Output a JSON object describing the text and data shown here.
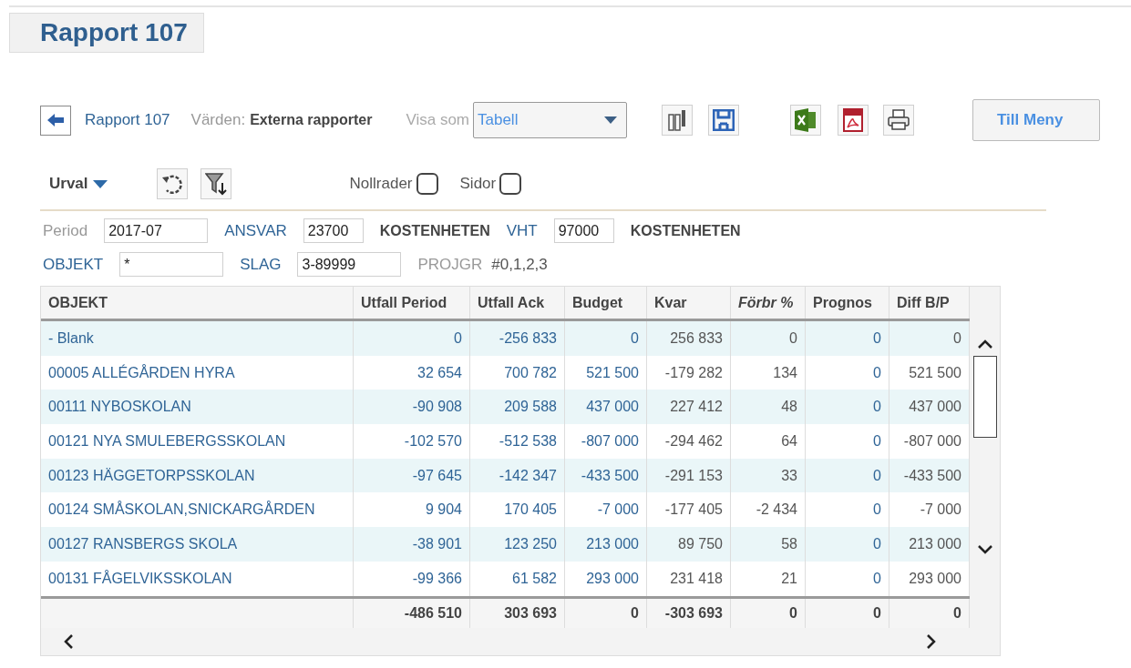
{
  "page_title": "Rapport 107",
  "toolbar": {
    "breadcrumb": "Rapport 107",
    "values_label": "Värden:",
    "values": "Externa rapporter",
    "view_label": "Visa som",
    "view_select": {
      "value": "Tabell"
    },
    "menu_button": "Till Meny"
  },
  "selection": {
    "label": "Urval",
    "checkboxes": [
      {
        "label": "Nollrader",
        "checked": false
      },
      {
        "label": "Sidor",
        "checked": false
      }
    ]
  },
  "filters": [
    [
      {
        "kind": "label",
        "text": "Period"
      },
      {
        "kind": "field",
        "value": "2017-07"
      },
      {
        "kind": "link",
        "text": "ANSVAR"
      },
      {
        "kind": "short_field",
        "value": "23700"
      },
      {
        "kind": "bold",
        "text": "KOSTENHETEN"
      },
      {
        "kind": "link",
        "text": "VHT"
      },
      {
        "kind": "short_field",
        "value": "97000"
      },
      {
        "kind": "bold",
        "text": "KOSTENHETEN"
      }
    ],
    [
      {
        "kind": "link",
        "text": "OBJEKT"
      },
      {
        "kind": "field",
        "value": "*"
      },
      {
        "kind": "link",
        "text": "SLAG"
      },
      {
        "kind": "field",
        "value": "3-89999"
      },
      {
        "kind": "label",
        "text": "PROJGR"
      },
      {
        "kind": "plain",
        "text": "#0,1,2,3"
      }
    ]
  ],
  "table": {
    "columns": [
      {
        "label": "OBJEKT",
        "kind": "link",
        "italic": false
      },
      {
        "label": "Utfall Period",
        "kind": "link",
        "italic": false
      },
      {
        "label": "Utfall Ack",
        "kind": "link",
        "italic": false
      },
      {
        "label": "Budget",
        "kind": "link",
        "italic": false
      },
      {
        "label": "Kvar",
        "kind": "plain",
        "italic": false
      },
      {
        "label": "Förbr %",
        "kind": "plain",
        "italic": true
      },
      {
        "label": "Prognos",
        "kind": "link",
        "italic": false
      },
      {
        "label": "Diff B/P",
        "kind": "plain",
        "italic": false
      }
    ],
    "rows": [
      [
        "- Blank",
        "0",
        "-256 833",
        "0",
        "256 833",
        "0",
        "0",
        "0"
      ],
      [
        "00005 ALLÉGÅRDEN HYRA",
        "32 654",
        "700 782",
        "521 500",
        "-179 282",
        "134",
        "0",
        "521 500"
      ],
      [
        "00111 NYBOSKOLAN",
        "-90 908",
        "209 588",
        "437 000",
        "227 412",
        "48",
        "0",
        "437 000"
      ],
      [
        "00121 NYA SMULEBERGSSKOLAN",
        "-102 570",
        "-512 538",
        "-807 000",
        "-294 462",
        "64",
        "0",
        "-807 000"
      ],
      [
        "00123 HÄGGETORPSSKOLAN",
        "-97 645",
        "-142 347",
        "-433 500",
        "-291 153",
        "33",
        "0",
        "-433 500"
      ],
      [
        "00124 SMÅSKOLAN,SNICKARGÅRDEN",
        "9 904",
        "170 405",
        "-7 000",
        "-177 405",
        "-2 434",
        "0",
        "-7 000"
      ],
      [
        "00127 RANSBERGS SKOLA",
        "-38 901",
        "123 250",
        "213 000",
        "89 750",
        "58",
        "0",
        "213 000"
      ],
      [
        "00131 FÅGELVIKSSKOLAN",
        "-99 366",
        "61 582",
        "293 000",
        "231 418",
        "21",
        "0",
        "293 000"
      ]
    ],
    "totals": [
      "-486 510",
      "303 693",
      "0",
      "-303 693",
      "0",
      "0",
      "0"
    ]
  }
}
